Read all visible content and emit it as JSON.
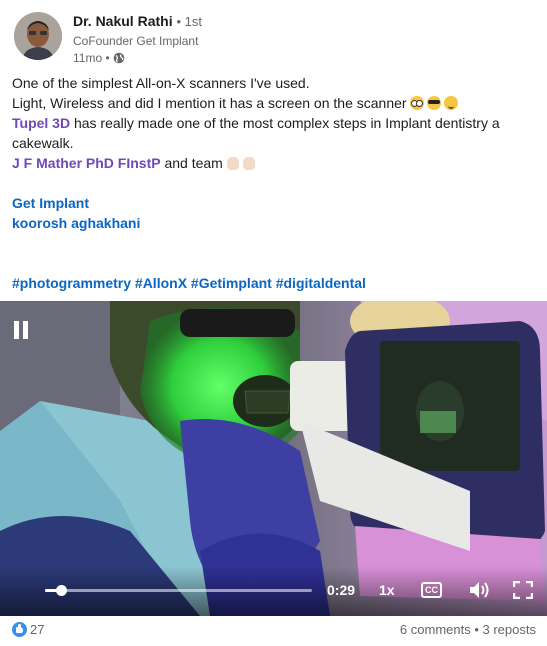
{
  "author": {
    "name": "Dr. Nakul Rathi",
    "degree": "• 1st",
    "headline": "CoFounder Get Implant",
    "time": "11mo •"
  },
  "post": {
    "line1": "One of the simplest All-on-X scanners I've used.",
    "line2": "Light, Wireless and did I mention it has a screen on the scanner",
    "mention1": "Tupel 3D",
    "line3_rest": " has really made one of the most complex steps in Implant dentistry a",
    "line4": "cakewalk.",
    "mention2": "J F Mather PhD FInstP",
    "line5_rest": " and team",
    "mention3": "Get Implant",
    "mention4": "koorosh aghakhani",
    "hashtags": "#photogrammetry #AllonX #Getimplant #digitaldental"
  },
  "video": {
    "time": "0:29",
    "speed": "1x",
    "cc_label": "CC",
    "progress": 0.06
  },
  "footer": {
    "reactions_count": "27",
    "comments": "6 comments",
    "separator": " • ",
    "reposts": "3 reposts"
  },
  "colors": {
    "mention": "#7049b6",
    "link": "#0a66c2",
    "like": "#378fe9"
  }
}
